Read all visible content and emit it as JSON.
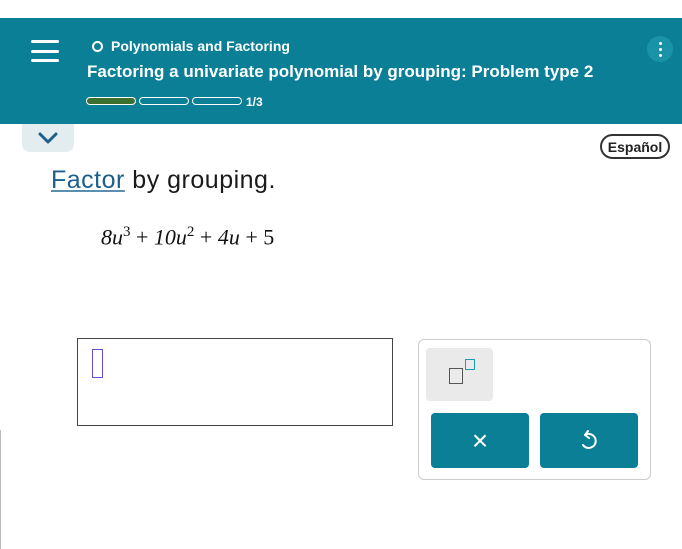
{
  "header": {
    "topic": "Polynomials and Factoring",
    "subtitle": "Factoring a univariate polynomial by grouping: Problem type 2",
    "progress": {
      "label": "1/3",
      "completed": 1,
      "total": 3
    },
    "bg_color": "#0b7f96"
  },
  "language_button": "Español",
  "question": {
    "link_word": "Factor",
    "rest": " by grouping.",
    "expression": {
      "t1_coef": "8u",
      "t1_exp": "3",
      "op1": " + ",
      "t2_coef": "10u",
      "t2_exp": "2",
      "op2": " + ",
      "t3": "4u",
      "op3": " + ",
      "t4": "5"
    }
  },
  "keypad": {
    "exponent_icon": "exponent-template-icon",
    "clear_symbol": "×",
    "undo_icon": "undo-icon"
  }
}
